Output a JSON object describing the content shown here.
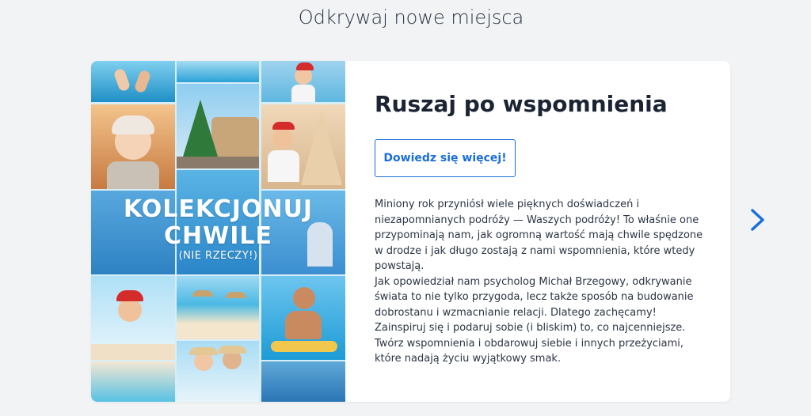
{
  "section": {
    "title": "Odkrywaj nowe miejsca"
  },
  "card": {
    "title": "Ruszaj po wspomnienia",
    "cta_label": "Dowiedz się więcej!",
    "paragraph1": "Miniony rok przyniósł wiele pięknych doświadczeń i niezapomnianych podróży — Waszych podróży! To właśnie one przypominają nam, jak ogromną wartość mają chwile spędzone w drodze i jak długo zostają z nami wspomnienia, które wtedy powstają.",
    "paragraph2": "Jak opowiedział nam psycholog Michał Brzegowy, odkrywanie świata to nie tylko przygoda, lecz także sposób na budowanie dobrostanu i wzmacnianie relacji. Dlatego zachęcamy! Zainspiruj się i podaruj sobie (i bliskim) to, co najcenniejsze. Twórz wspomnienia i obdarowuj siebie i innych przeżyciami, które nadają życiu wyjątkowy smak."
  },
  "collage": {
    "line1": "KOLEKCJONUJ",
    "line2": "CHWILE",
    "line3": "(NIE RZECZY!)"
  },
  "nav": {
    "next_icon": "chevron-right-icon"
  },
  "colors": {
    "accent": "#1a6ed8",
    "background": "#f1f3f5",
    "card": "#ffffff"
  }
}
